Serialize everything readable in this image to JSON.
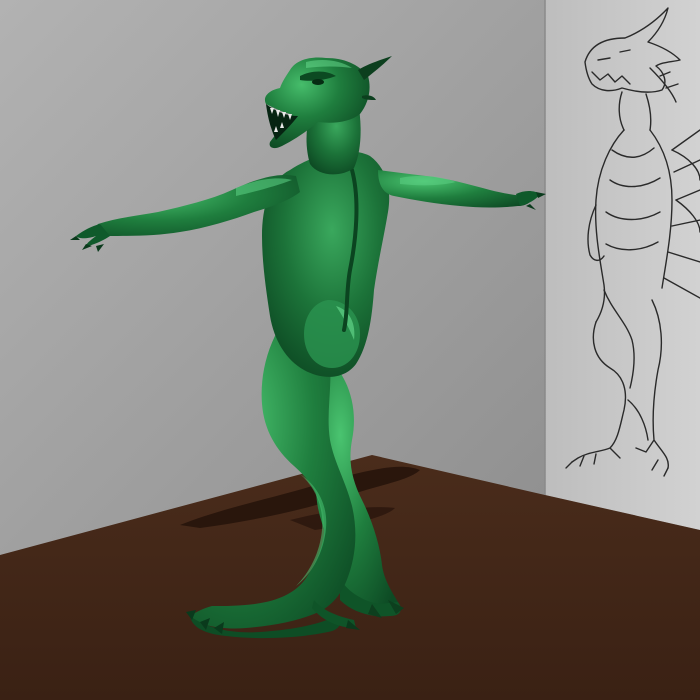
{
  "scene": {
    "subject": "dragon-creature-3d-model",
    "pose": "t-pose",
    "colors": {
      "creature": "#1f7a3c",
      "creature_highlight": "#3fb565",
      "creature_shadow": "#0c4a22",
      "wall_left": "#a9a9a9",
      "wall_right": "#c9c9c9",
      "floor": "#3e2416",
      "sketch_line": "#2a2a2a",
      "sky_corner": "#cfcfcf"
    },
    "reference_sketch": {
      "subject": "dragon-line-drawing",
      "style": "pencil-outline"
    }
  }
}
